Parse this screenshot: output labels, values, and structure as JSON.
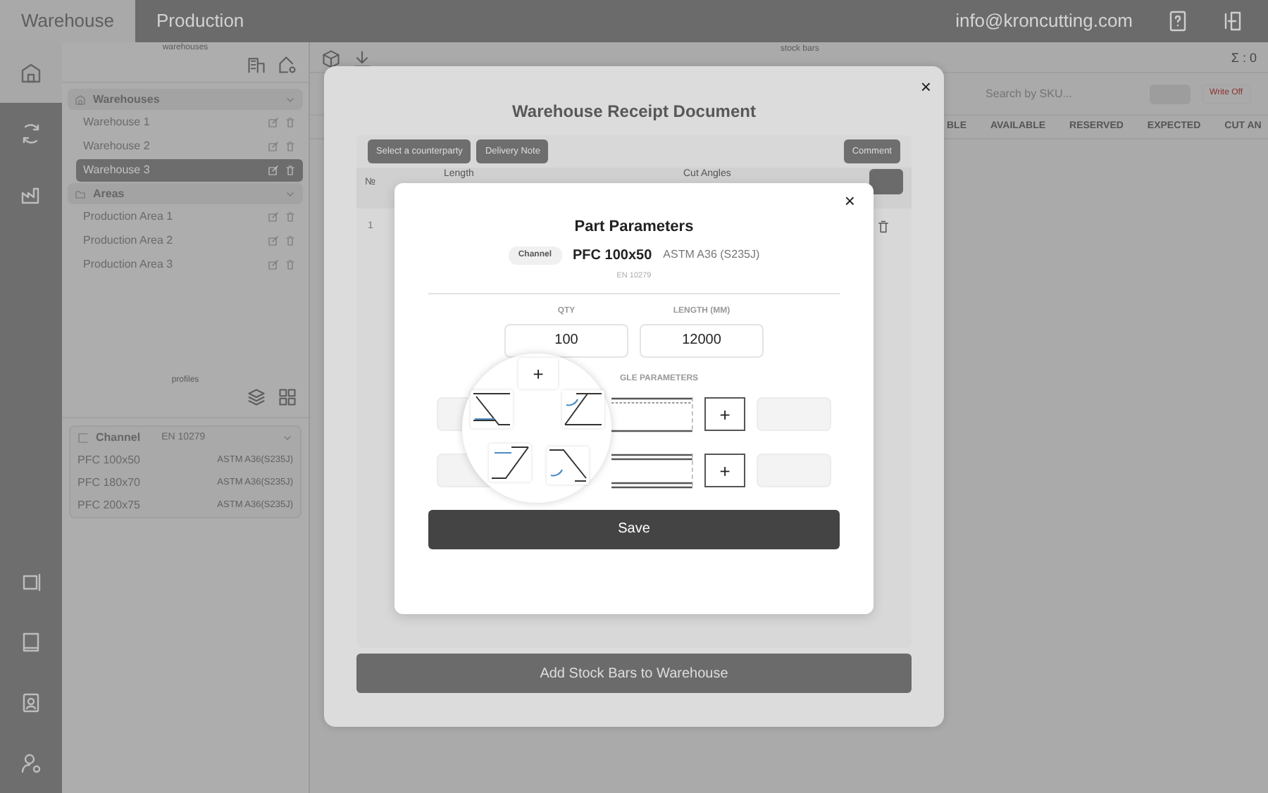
{
  "top_nav": {
    "tabs": [
      {
        "label": "Warehouse",
        "selected": true
      },
      {
        "label": "Production",
        "selected": false
      }
    ],
    "user_email": "info@kroncutting.com"
  },
  "rail": {
    "top_items": [
      {
        "kind": "warehouse",
        "selected": true
      },
      {
        "kind": "exchange",
        "selected": false
      },
      {
        "kind": "factory",
        "selected": false
      }
    ],
    "bottom_items": [
      {
        "kind": "frame"
      },
      {
        "kind": "book"
      },
      {
        "kind": "contact"
      },
      {
        "kind": "user-settings"
      }
    ]
  },
  "warehouses_panel": {
    "caption": "warehouses",
    "groups": [
      {
        "title": "Warehouses",
        "kind": "warehouse",
        "expanded": true,
        "items": [
          {
            "label": "Warehouse 1",
            "selected": false
          },
          {
            "label": "Warehouse 2",
            "selected": false
          },
          {
            "label": "Warehouse 3",
            "selected": true
          }
        ]
      },
      {
        "title": "Areas",
        "kind": "folder",
        "expanded": true,
        "items": [
          {
            "label": "Production Area 1",
            "selected": false
          },
          {
            "label": "Production Area 2",
            "selected": false
          },
          {
            "label": "Production Area 3",
            "selected": false
          }
        ]
      }
    ]
  },
  "profiles_panel": {
    "caption": "profiles",
    "group": {
      "title": "Channel",
      "standard": "EN 10279",
      "expanded": true,
      "items": [
        {
          "name": "PFC 100x50",
          "grade": "ASTM A36(S235J)"
        },
        {
          "name": "PFC 180x70",
          "grade": "ASTM A36(S235J)"
        },
        {
          "name": "PFC 200x75",
          "grade": "ASTM A36(S235J)"
        }
      ]
    }
  },
  "stock_panel": {
    "caption": "stock bars",
    "sum": "Σ : 0",
    "search": {
      "placeholder": "Search by SKU..."
    },
    "write_off": "Write Off",
    "columns": [
      "BLE",
      "AVAILABLE",
      "RESERVED",
      "EXPECTED",
      "CUT AN"
    ]
  },
  "receipt_modal": {
    "close": "×",
    "title": "Warehouse Receipt Document",
    "buttons": [
      "Select a counterparty",
      "Delivery Note"
    ],
    "comment": "Comment",
    "columns": [
      "№",
      "Length",
      "Cut Angles"
    ],
    "rows": [
      {
        "number": "1"
      }
    ],
    "submit": "Add Stock Bars to Warehouse"
  },
  "part_modal": {
    "close": "×",
    "title": "Part Parameters",
    "profile_type": "Channel",
    "profile": "PFC 100x50",
    "grade": "ASTM A36 (S235J)",
    "standard": "EN 10279",
    "qty": {
      "label": "QTY",
      "value": "100"
    },
    "length": {
      "label": "LENGTH (MM)",
      "value": "12000"
    },
    "angle_label": "GLE PARAMETERS",
    "rows": [
      {
        "kind": "straight",
        "add": "+"
      },
      {
        "kind": "double",
        "add": "+"
      }
    ],
    "save": "Save"
  },
  "angle_picker": {
    "options": [
      {
        "kind": "plus",
        "label": "+"
      },
      {
        "kind": "bevel-down-k"
      },
      {
        "kind": "bevel-up-a"
      },
      {
        "kind": "bevel-up-k"
      },
      {
        "kind": "bevel-down-a"
      }
    ]
  }
}
